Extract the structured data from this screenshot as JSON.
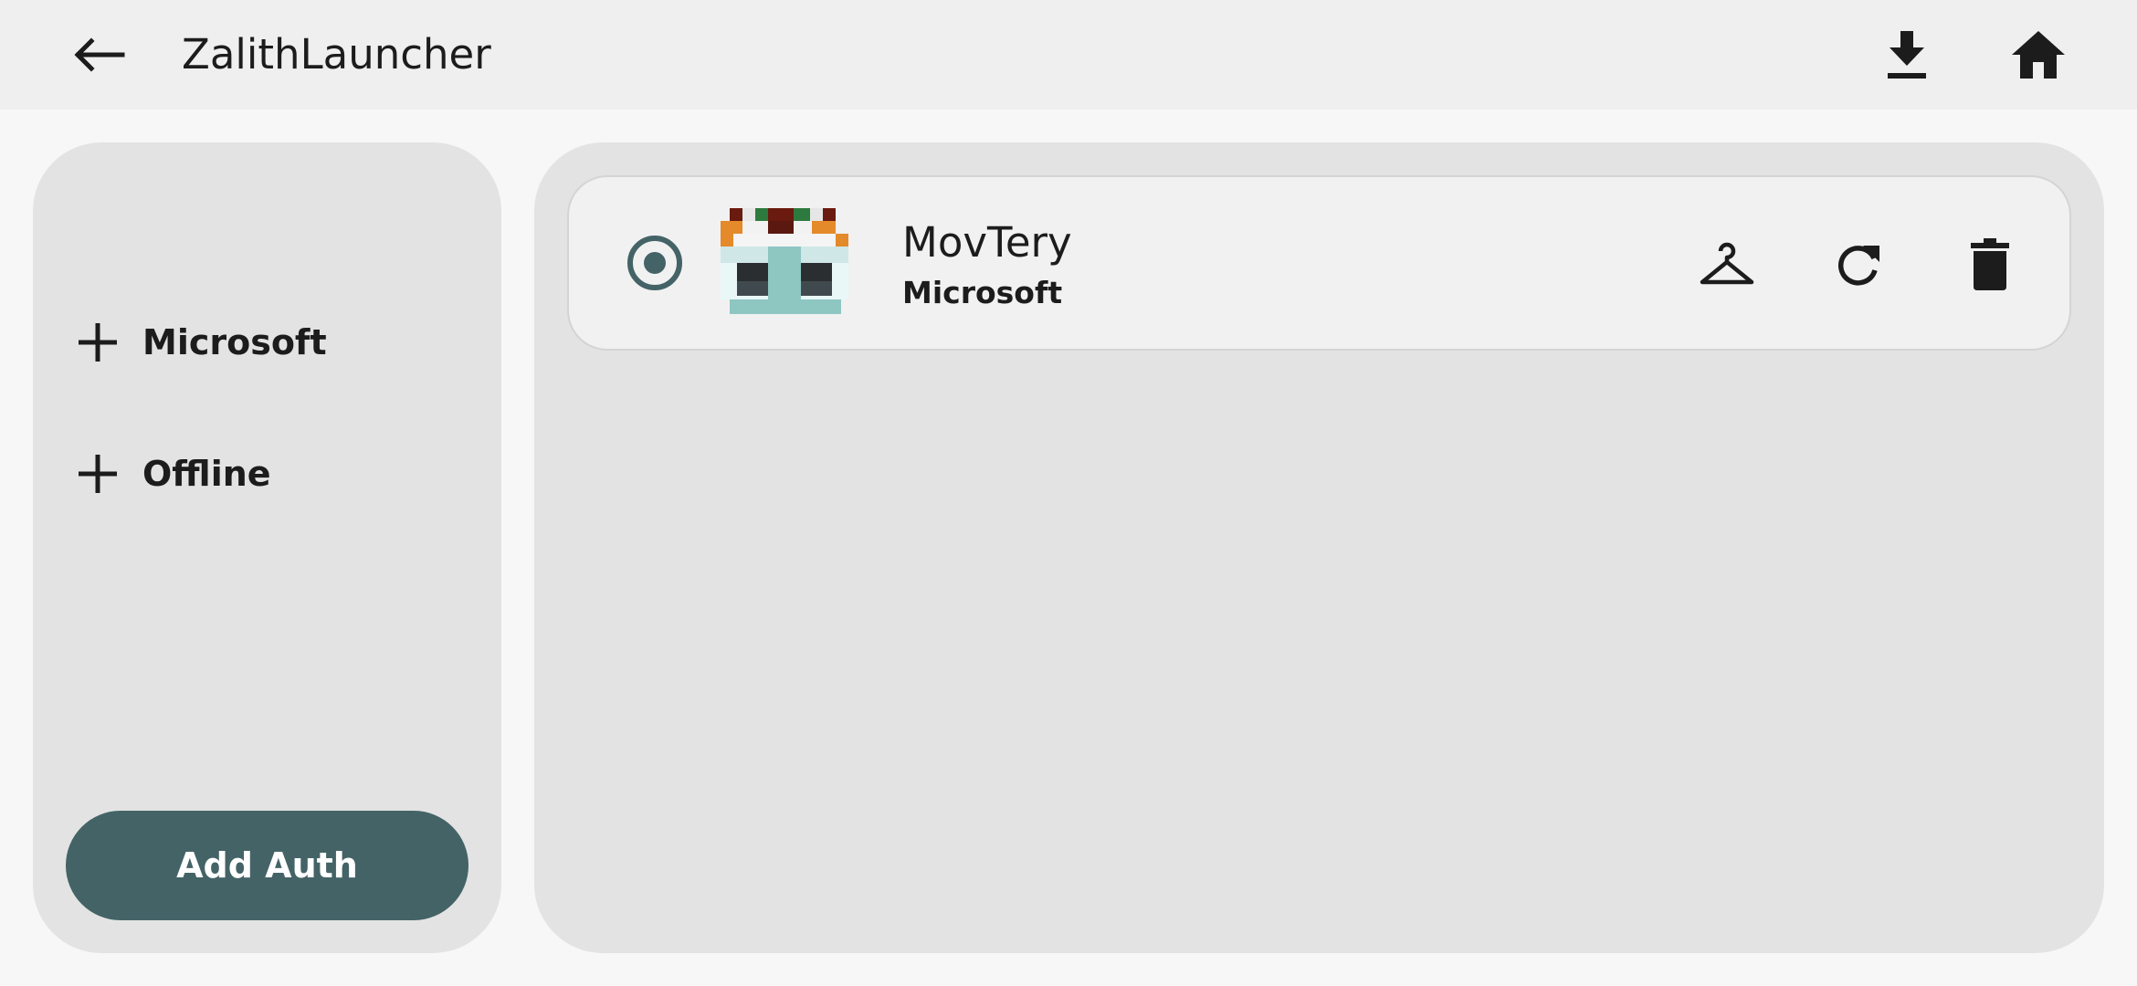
{
  "app": {
    "title": "ZalithLauncher"
  },
  "topbar": {
    "back_icon": "arrow-left-icon",
    "download_icon": "download-icon",
    "home_icon": "home-icon"
  },
  "sidebar": {
    "options": [
      {
        "icon": "plus-icon",
        "label": "Microsoft"
      },
      {
        "icon": "plus-icon",
        "label": "Offline"
      }
    ],
    "add_auth_label": "Add Auth"
  },
  "accounts": [
    {
      "name": "MovTery",
      "type": "Microsoft",
      "selected": true,
      "avatar": "player-head-avatar",
      "actions": [
        {
          "icon": "hanger-icon"
        },
        {
          "icon": "refresh-icon"
        },
        {
          "icon": "trash-icon"
        }
      ]
    }
  ],
  "colors": {
    "accent": "#446367",
    "topbar_bg": "#efefef",
    "page_bg": "#f7f7f7",
    "panel_bg": "#e3e3e3",
    "card_bg": "#f1f1f1"
  }
}
